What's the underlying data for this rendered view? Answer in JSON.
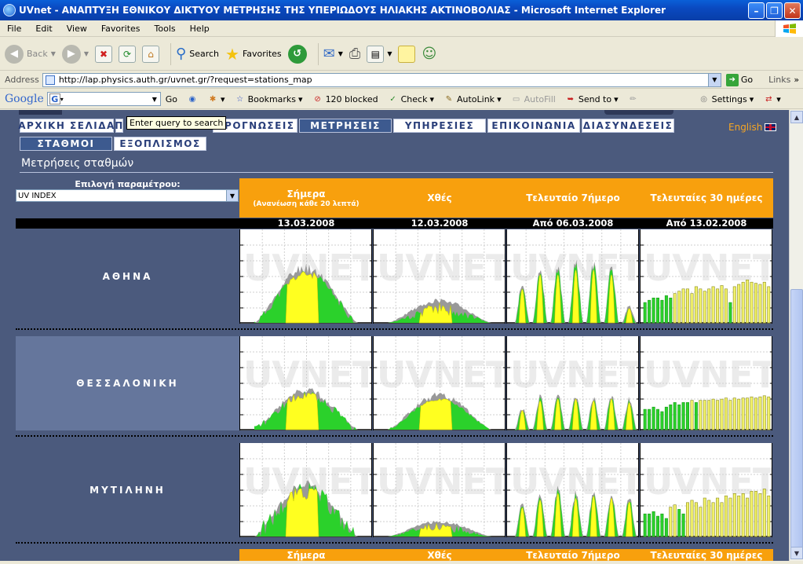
{
  "window": {
    "title": "UVnet - ΑΝΑΠΤΥΞΗ ΕΘΝΙΚΟΥ ΔΙΚΤΥΟΥ ΜΕΤΡΗΣΗΣ ΤΗΣ ΥΠΕΡΙΩΔΟΥΣ ΗΛΙΑΚΗΣ ΑΚΤΙΝΟΒΟΛΙΑΣ - Microsoft Internet Explorer",
    "minimize": "–",
    "maximize": "❐",
    "close": "✕"
  },
  "menu": [
    "File",
    "Edit",
    "View",
    "Favorites",
    "Tools",
    "Help"
  ],
  "toolbar": {
    "back": "Back",
    "search": "Search",
    "favorites": "Favorites"
  },
  "address": {
    "label": "Address",
    "url": "http://lap.physics.auth.gr/uvnet.gr/?request=stations_map",
    "go": "Go",
    "links": "Links"
  },
  "google": {
    "logo": "Google",
    "go": "Go",
    "bookmarks": "Bookmarks",
    "blocked": "120 blocked",
    "check": "Check",
    "autolink": "AutoLink",
    "autofill": "AutoFill",
    "sendto": "Send to",
    "settings": "Settings"
  },
  "tooltip": "Enter query to search",
  "nav_main": [
    {
      "label": "ΑΡΧΙΚΗ ΣΕΛΙΔΑ",
      "active": false
    },
    {
      "label": "Π",
      "active": false
    },
    {
      "label": "ΠΡΟΓΝΩΣΕΙΣ",
      "active": false
    },
    {
      "label": "ΜΕΤΡΗΣΕΙΣ",
      "active": true
    },
    {
      "label": "ΥΠΗΡΕΣΙΕΣ",
      "active": false
    },
    {
      "label": "ΕΠΙΚΟΙΝΩΝΙΑ",
      "active": false
    },
    {
      "label": "ΔΙΑΣΥΝΔΕΣΕΙΣ",
      "active": false
    }
  ],
  "nav_sub": [
    {
      "label": "ΣΤΑΘΜΟΙ",
      "active": true
    },
    {
      "label": "ΕΞΟΠΛΙΣΜΟΣ",
      "active": false
    }
  ],
  "language": "English",
  "page_title": "Μετρήσεις σταθμών",
  "parameter": {
    "label": "Επιλογή παραμέτρου:",
    "selected": "UV INDEX"
  },
  "columns": [
    {
      "title": "Σήμερα",
      "subtitle": "(Ανανέωση κάθε 20 λεπτά)",
      "date": "13.03.2008"
    },
    {
      "title": "Χθές",
      "subtitle": "",
      "date": "12.03.2008"
    },
    {
      "title": "Τελευταίο 7ήμερο",
      "subtitle": "",
      "date": "Από 06.03.2008"
    },
    {
      "title": "Τελευταίες 30 ημέρες",
      "subtitle": "",
      "date": "Από 13.02.2008"
    }
  ],
  "watermark": "UVNET",
  "stations": [
    {
      "name": "ΑΘΗΝΑ",
      "today": {
        "peak": 0.45,
        "shape": "day-partial",
        "clouds": 0.1
      },
      "yesterday": {
        "peak": 0.18,
        "shape": "day-cloudy",
        "clouds": 0.5
      },
      "week": {
        "peaks": [
          0.35,
          0.5,
          0.5,
          0.55,
          0.55,
          0.5,
          0.15
        ]
      },
      "month": [
        0.18,
        0.2,
        0.22,
        0.22,
        0.2,
        0.24,
        0.22,
        0.26,
        0.28,
        0.3,
        0.3,
        0.26,
        0.32,
        0.3,
        0.28,
        0.3,
        0.32,
        0.3,
        0.33,
        0.3,
        0.18,
        0.32,
        0.34,
        0.36,
        0.38,
        0.36,
        0.35,
        0.34,
        0.36,
        0.32
      ]
    },
    {
      "name": "ΘΕΣΣΑΛΟΝΙΚΗ",
      "today": {
        "peak": 0.32,
        "shape": "day-partial",
        "clouds": 0.15
      },
      "yesterday": {
        "peak": 0.28,
        "shape": "day-clear",
        "clouds": 0.05
      },
      "week": {
        "peaks": [
          0.2,
          0.3,
          0.32,
          0.32,
          0.3,
          0.32,
          0.28
        ]
      },
      "month": [
        0.18,
        0.18,
        0.2,
        0.18,
        0.16,
        0.2,
        0.22,
        0.24,
        0.22,
        0.24,
        0.24,
        0.26,
        0.24,
        0.26,
        0.26,
        0.26,
        0.27,
        0.26,
        0.27,
        0.28,
        0.26,
        0.28,
        0.27,
        0.28,
        0.28,
        0.29,
        0.28,
        0.29,
        0.3,
        0.29
      ]
    },
    {
      "name": "ΜΥΤΙΛΗΝΗ",
      "today": {
        "peak": 0.42,
        "shape": "day-partial",
        "clouds": 0.25
      },
      "yesterday": {
        "peak": 0.12,
        "shape": "day-cloudy",
        "clouds": 0.6
      },
      "week": {
        "peaks": [
          0.3,
          0.38,
          0.45,
          0.4,
          0.42,
          0.4,
          0.36
        ]
      },
      "month": [
        0.2,
        0.2,
        0.22,
        0.18,
        0.2,
        0.16,
        0.26,
        0.28,
        0.24,
        0.2,
        0.3,
        0.32,
        0.3,
        0.26,
        0.34,
        0.32,
        0.3,
        0.34,
        0.3,
        0.36,
        0.34,
        0.38,
        0.36,
        0.38,
        0.34,
        0.4,
        0.4,
        0.38,
        0.42,
        0.36
      ]
    }
  ],
  "repeat_header": [
    "Σήμερα",
    "Χθές",
    "Τελευταίο 7ήμερο",
    "Τελευταίες 30 ημέρες"
  ]
}
